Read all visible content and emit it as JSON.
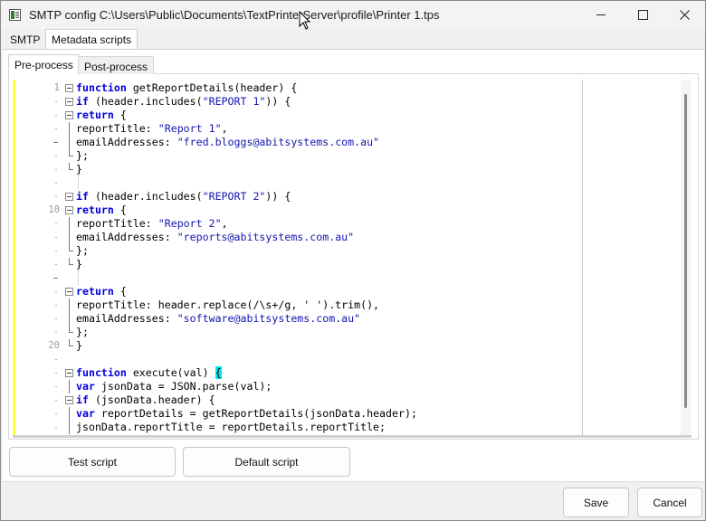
{
  "window": {
    "title": "SMTP config C:\\Users\\Public\\Documents\\TextPrinterServer\\profile\\Printer 1.tps"
  },
  "tabs": [
    {
      "label": "SMTP",
      "active": false
    },
    {
      "label": "Metadata scripts",
      "active": true
    }
  ],
  "subtabs": [
    {
      "label": "Pre-process",
      "active": true
    },
    {
      "label": "Post-process",
      "active": false
    }
  ],
  "editor": {
    "line_numbers": {
      "1": "1",
      "10": "10",
      "20": "20"
    },
    "lines": [
      {
        "kw": "function",
        "rest": " getReportDetails(header) {"
      },
      {
        "kw": "if",
        "rest": " (header.includes(",
        "str": "\"REPORT 1\"",
        "tail": ")) {"
      },
      {
        "kw": "return",
        "rest": " {"
      },
      {
        "text": "reportTitle: ",
        "str": "\"Report 1\"",
        "tail": ","
      },
      {
        "text": "emailAddresses: ",
        "str": "\"fred.bloggs@abitsystems.com.au\"",
        "tail": ""
      },
      {
        "text": "};"
      },
      {
        "text": "}"
      },
      {
        "text": ""
      },
      {
        "kw": "if",
        "rest": " (header.includes(",
        "str": "\"REPORT 2\"",
        "tail": ")) {"
      },
      {
        "kw": "return",
        "rest": " {"
      },
      {
        "text": "reportTitle: ",
        "str": "\"Report 2\"",
        "tail": ","
      },
      {
        "text": "emailAddresses: ",
        "str": "\"reports@abitsystems.com.au\"",
        "tail": ""
      },
      {
        "text": "};"
      },
      {
        "text": "}"
      },
      {
        "text": ""
      },
      {
        "kw": "return",
        "rest": " {"
      },
      {
        "text": "reportTitle: header.replace(/\\s+/g, ' ').trim(),"
      },
      {
        "text": "emailAddresses: ",
        "str": "\"software@abitsystems.com.au\"",
        "tail": ""
      },
      {
        "text": "};"
      },
      {
        "text": "}"
      },
      {
        "text": ""
      },
      {
        "kw": "function",
        "rest": " execute(val) ",
        "brace": "{"
      },
      {
        "kw": "var",
        "rest": " jsonData = JSON.parse(val);"
      },
      {
        "kw": "if",
        "rest": " (jsonData.header) {"
      },
      {
        "kw": "var",
        "rest": " reportDetails = getReportDetails(jsonData.header);"
      },
      {
        "text": "jsonData.reportTitle = reportDetails.reportTitle;"
      }
    ]
  },
  "buttons": {
    "test_script": "Test script",
    "default_script": "Default script",
    "save": "Save",
    "cancel": "Cancel"
  },
  "icons": {
    "app": "app-icon",
    "minimize": "minimize-icon",
    "maximize": "maximize-icon",
    "close": "close-icon"
  }
}
